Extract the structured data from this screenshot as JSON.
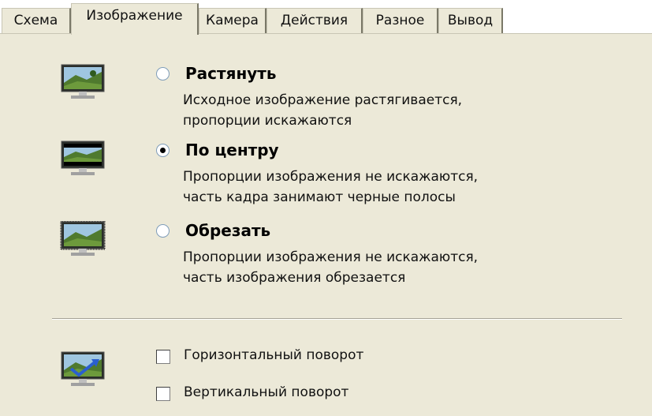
{
  "tabs": [
    {
      "label": "Схема"
    },
    {
      "label": "Изображение"
    },
    {
      "label": "Камера"
    },
    {
      "label": "Действия"
    },
    {
      "label": "Разное"
    },
    {
      "label": "Вывод"
    }
  ],
  "active_tab": "Изображение",
  "options": [
    {
      "title": "Растянуть",
      "desc1": "Исходное изображение растягивается,",
      "desc2": "пропорции искажаются",
      "selected": false
    },
    {
      "title": "По центру",
      "desc1": "Пропорции изображения не искажаются,",
      "desc2": "часть кадра занимают черные полосы",
      "selected": true
    },
    {
      "title": "Обрезать",
      "desc1": "Пропорции изображения не искажаются,",
      "desc2": "часть изображения обрезается",
      "selected": false
    }
  ],
  "checkboxes": [
    {
      "label": "Горизонтальный поворот",
      "checked": false
    },
    {
      "label": "Вертикальный поворот",
      "checked": false
    }
  ],
  "colors": {
    "panel_bg": "#ece9d8",
    "radio_border": "#7f9db9"
  },
  "icons": [
    "monitor-stretch-icon",
    "monitor-center-icon",
    "monitor-crop-icon",
    "monitor-flip-icon"
  ]
}
